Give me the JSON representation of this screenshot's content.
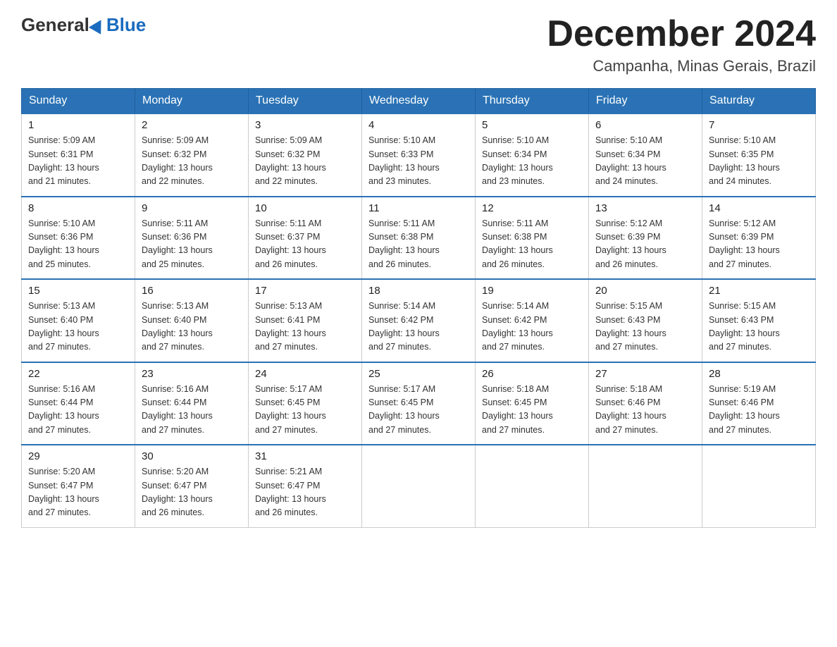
{
  "logo": {
    "general": "General",
    "blue": "Blue"
  },
  "title": "December 2024",
  "subtitle": "Campanha, Minas Gerais, Brazil",
  "days_of_week": [
    "Sunday",
    "Monday",
    "Tuesday",
    "Wednesday",
    "Thursday",
    "Friday",
    "Saturday"
  ],
  "weeks": [
    [
      {
        "day": "1",
        "sunrise": "5:09 AM",
        "sunset": "6:31 PM",
        "daylight": "13 hours and 21 minutes."
      },
      {
        "day": "2",
        "sunrise": "5:09 AM",
        "sunset": "6:32 PM",
        "daylight": "13 hours and 22 minutes."
      },
      {
        "day": "3",
        "sunrise": "5:09 AM",
        "sunset": "6:32 PM",
        "daylight": "13 hours and 22 minutes."
      },
      {
        "day": "4",
        "sunrise": "5:10 AM",
        "sunset": "6:33 PM",
        "daylight": "13 hours and 23 minutes."
      },
      {
        "day": "5",
        "sunrise": "5:10 AM",
        "sunset": "6:34 PM",
        "daylight": "13 hours and 23 minutes."
      },
      {
        "day": "6",
        "sunrise": "5:10 AM",
        "sunset": "6:34 PM",
        "daylight": "13 hours and 24 minutes."
      },
      {
        "day": "7",
        "sunrise": "5:10 AM",
        "sunset": "6:35 PM",
        "daylight": "13 hours and 24 minutes."
      }
    ],
    [
      {
        "day": "8",
        "sunrise": "5:10 AM",
        "sunset": "6:36 PM",
        "daylight": "13 hours and 25 minutes."
      },
      {
        "day": "9",
        "sunrise": "5:11 AM",
        "sunset": "6:36 PM",
        "daylight": "13 hours and 25 minutes."
      },
      {
        "day": "10",
        "sunrise": "5:11 AM",
        "sunset": "6:37 PM",
        "daylight": "13 hours and 26 minutes."
      },
      {
        "day": "11",
        "sunrise": "5:11 AM",
        "sunset": "6:38 PM",
        "daylight": "13 hours and 26 minutes."
      },
      {
        "day": "12",
        "sunrise": "5:11 AM",
        "sunset": "6:38 PM",
        "daylight": "13 hours and 26 minutes."
      },
      {
        "day": "13",
        "sunrise": "5:12 AM",
        "sunset": "6:39 PM",
        "daylight": "13 hours and 26 minutes."
      },
      {
        "day": "14",
        "sunrise": "5:12 AM",
        "sunset": "6:39 PM",
        "daylight": "13 hours and 27 minutes."
      }
    ],
    [
      {
        "day": "15",
        "sunrise": "5:13 AM",
        "sunset": "6:40 PM",
        "daylight": "13 hours and 27 minutes."
      },
      {
        "day": "16",
        "sunrise": "5:13 AM",
        "sunset": "6:40 PM",
        "daylight": "13 hours and 27 minutes."
      },
      {
        "day": "17",
        "sunrise": "5:13 AM",
        "sunset": "6:41 PM",
        "daylight": "13 hours and 27 minutes."
      },
      {
        "day": "18",
        "sunrise": "5:14 AM",
        "sunset": "6:42 PM",
        "daylight": "13 hours and 27 minutes."
      },
      {
        "day": "19",
        "sunrise": "5:14 AM",
        "sunset": "6:42 PM",
        "daylight": "13 hours and 27 minutes."
      },
      {
        "day": "20",
        "sunrise": "5:15 AM",
        "sunset": "6:43 PM",
        "daylight": "13 hours and 27 minutes."
      },
      {
        "day": "21",
        "sunrise": "5:15 AM",
        "sunset": "6:43 PM",
        "daylight": "13 hours and 27 minutes."
      }
    ],
    [
      {
        "day": "22",
        "sunrise": "5:16 AM",
        "sunset": "6:44 PM",
        "daylight": "13 hours and 27 minutes."
      },
      {
        "day": "23",
        "sunrise": "5:16 AM",
        "sunset": "6:44 PM",
        "daylight": "13 hours and 27 minutes."
      },
      {
        "day": "24",
        "sunrise": "5:17 AM",
        "sunset": "6:45 PM",
        "daylight": "13 hours and 27 minutes."
      },
      {
        "day": "25",
        "sunrise": "5:17 AM",
        "sunset": "6:45 PM",
        "daylight": "13 hours and 27 minutes."
      },
      {
        "day": "26",
        "sunrise": "5:18 AM",
        "sunset": "6:45 PM",
        "daylight": "13 hours and 27 minutes."
      },
      {
        "day": "27",
        "sunrise": "5:18 AM",
        "sunset": "6:46 PM",
        "daylight": "13 hours and 27 minutes."
      },
      {
        "day": "28",
        "sunrise": "5:19 AM",
        "sunset": "6:46 PM",
        "daylight": "13 hours and 27 minutes."
      }
    ],
    [
      {
        "day": "29",
        "sunrise": "5:20 AM",
        "sunset": "6:47 PM",
        "daylight": "13 hours and 27 minutes."
      },
      {
        "day": "30",
        "sunrise": "5:20 AM",
        "sunset": "6:47 PM",
        "daylight": "13 hours and 26 minutes."
      },
      {
        "day": "31",
        "sunrise": "5:21 AM",
        "sunset": "6:47 PM",
        "daylight": "13 hours and 26 minutes."
      },
      null,
      null,
      null,
      null
    ]
  ],
  "labels": {
    "sunrise": "Sunrise:",
    "sunset": "Sunset:",
    "daylight": "Daylight:"
  }
}
